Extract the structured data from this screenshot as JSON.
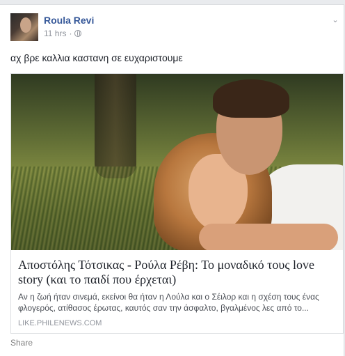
{
  "post": {
    "author": "Roula Revi",
    "time": "11 hrs",
    "separator": "·",
    "privacy_icon": "globe-icon",
    "options_icon": "chevron-down-icon",
    "text": "αχ βρε καλλια καστανη σε ευχαριστουμε"
  },
  "link": {
    "title": "Αποστόλης Τότσικας - Ρούλα Ρέβη: Το μοναδικό τους love story (και το παιδί που έρχεται)",
    "description": "Αν η ζωή ήταν σινεμά, εκείνοι θα ήταν η Λούλα και ο Σέιλορ και η σχέση τους ένας φλογερός, ατίθασος έρωτας, καυτός σαν την άσφαλτο, βγαλμένος λες από το...",
    "domain": "LIKE.PHILENEWS.COM"
  },
  "actions": {
    "share_label": "Share"
  },
  "colors": {
    "author": "#365899",
    "text": "#1d2129",
    "meta": "#90949c",
    "background": "#e9ebee"
  }
}
